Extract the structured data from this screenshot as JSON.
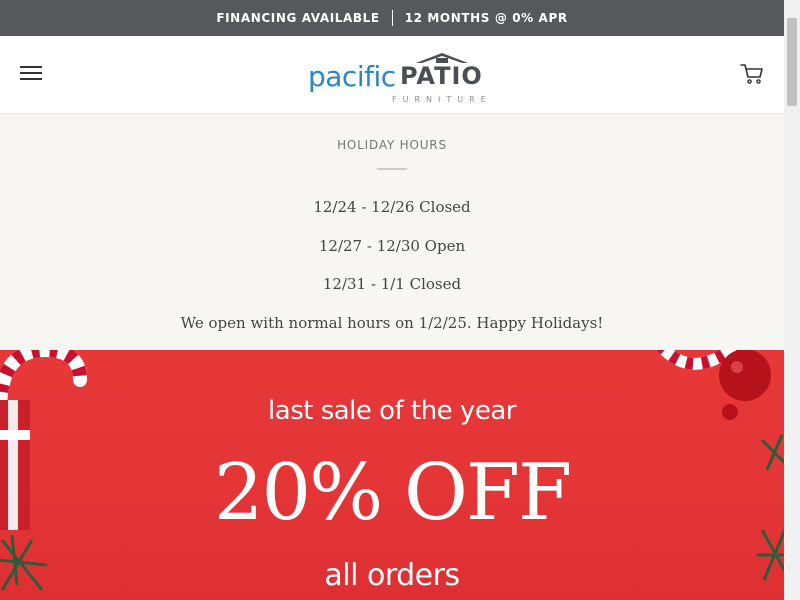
{
  "announcement": {
    "left": "FINANCING AVAILABLE",
    "right": "12 MONTHS @ 0% APR"
  },
  "logo": {
    "script": "pacific",
    "word": "PATIO",
    "sub": "FURNITURE"
  },
  "icons": {
    "menu": "hamburger-menu-icon",
    "cart": "shopping-cart-icon"
  },
  "notice": {
    "title": "HOLIDAY HOURS",
    "lines": [
      "12/24 - 12/26 Closed",
      "12/27 - 12/30 Open",
      "12/31 - 1/1 Closed"
    ],
    "footer": "We open with normal hours on 1/2/25. Happy Holidays!"
  },
  "promo": {
    "line1": "last sale of the year",
    "line2": "20% OFF",
    "line3": "all orders"
  },
  "colors": {
    "announce_bg": "#57585c",
    "notice_bg": "#f7f6f2",
    "promo_bg": "#e43637",
    "logo_blue": "#2b85c7",
    "logo_gray": "#4b4e53"
  }
}
